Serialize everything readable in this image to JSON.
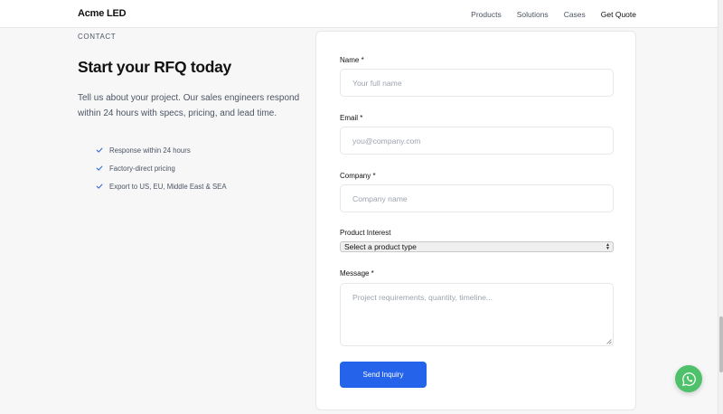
{
  "header": {
    "logo": "Acme LED",
    "nav": [
      "Products",
      "Solutions",
      "Cases",
      "Get Quote"
    ]
  },
  "intro": {
    "label": "CONTACT",
    "title": "Start your RFQ today",
    "description": "Tell us about your project. Our sales engineers respond within 24 hours with specs, pricing, and lead time.",
    "benefits": [
      "Response within 24 hours",
      "Factory-direct pricing",
      "Export to US, EU, Middle East & SEA"
    ]
  },
  "form": {
    "name": {
      "label": "Name *",
      "placeholder": "Your full name"
    },
    "email": {
      "label": "Email *",
      "placeholder": "you@company.com"
    },
    "company": {
      "label": "Company *",
      "placeholder": "Company name"
    },
    "product": {
      "label": "Product Interest",
      "selected": "Select a product type"
    },
    "message": {
      "label": "Message *",
      "placeholder": "Project requirements, quantity, timeline..."
    },
    "submit_label": "Send Inquiry"
  },
  "icons": {
    "check": "check-icon",
    "whatsapp": "whatsapp-icon"
  },
  "colors": {
    "accent": "#2563eb",
    "check": "#3b6fd4",
    "whatsapp": "#4fc16a"
  }
}
